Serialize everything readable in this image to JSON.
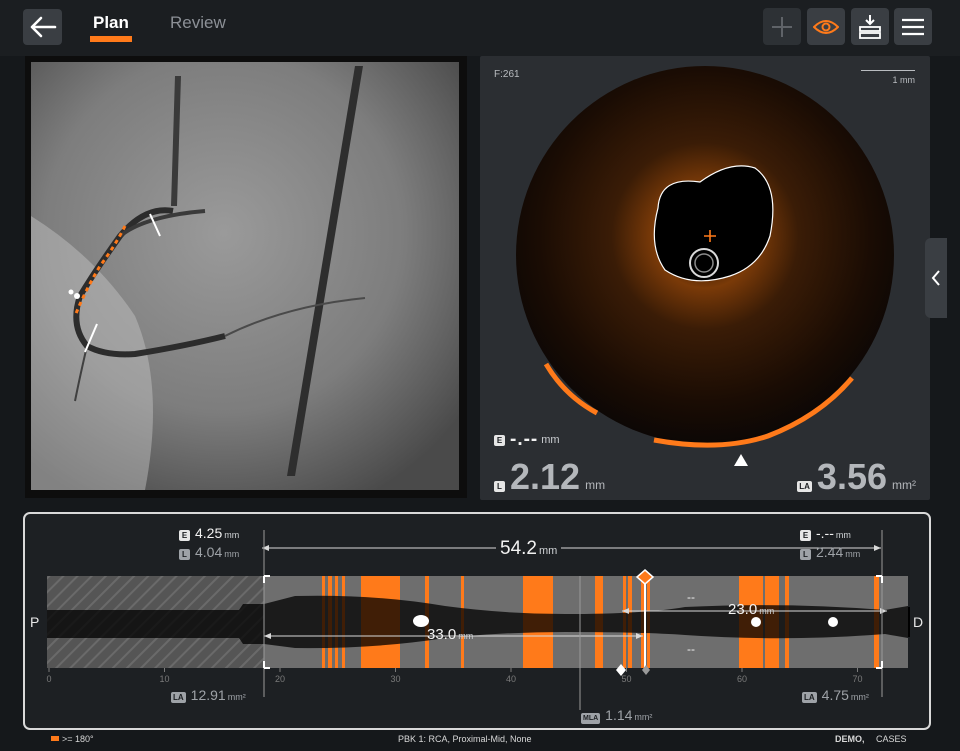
{
  "header": {
    "tabs": [
      {
        "label": "Plan",
        "active": true
      },
      {
        "label": "Review",
        "active": false
      }
    ]
  },
  "colors": {
    "accent": "#ff7a1a",
    "background": "#15181b",
    "panel": "#2b2e32"
  },
  "icons": [
    "back-arrow-icon",
    "plus-icon",
    "eye-icon",
    "export-icon",
    "menu-icon",
    "chevron-left-icon"
  ],
  "oct": {
    "frame": "F:261",
    "scale": "1 mm",
    "e_badge": "E",
    "e_value": "-.--",
    "e_unit": "mm",
    "l_badge": "L",
    "l_value": "2.12",
    "l_unit": "mm",
    "la_badge": "LA",
    "la_value": "3.56",
    "la_unit": "mm²"
  },
  "longitudinal": {
    "proximal_label": "P",
    "distal_label": "D",
    "left_ref": {
      "e_badge": "E",
      "e_value": "4.25",
      "e_unit": "mm",
      "l_badge": "L",
      "l_value": "4.04",
      "l_unit": "mm",
      "la_badge": "LA",
      "la_value": "12.91",
      "la_unit": "mm²"
    },
    "right_ref": {
      "e_badge": "E",
      "e_value": "-.--",
      "e_unit": "mm",
      "l_badge": "L",
      "l_value": "2.44",
      "l_unit": "mm",
      "la_badge": "LA",
      "la_value": "4.75",
      "la_unit": "mm²"
    },
    "total_length": {
      "value": "54.2",
      "unit": "mm"
    },
    "segment_left": {
      "value": "33.0",
      "unit": "mm"
    },
    "segment_right": {
      "value": "23.0",
      "unit": "mm"
    },
    "dash_top": "--",
    "dash_bottom": "--",
    "mla": {
      "badge": "MLA",
      "value": "1.14",
      "unit": "mm²"
    },
    "ticks": [
      "0",
      "10",
      "20",
      "30",
      "40",
      "50",
      "60",
      "70"
    ]
  },
  "footer": {
    "legend": ">= 180°",
    "vessel_info": "PBK 1:  RCA,  Proximal-Mid,  None",
    "demo": "DEMO,",
    "cases": "CASES"
  }
}
